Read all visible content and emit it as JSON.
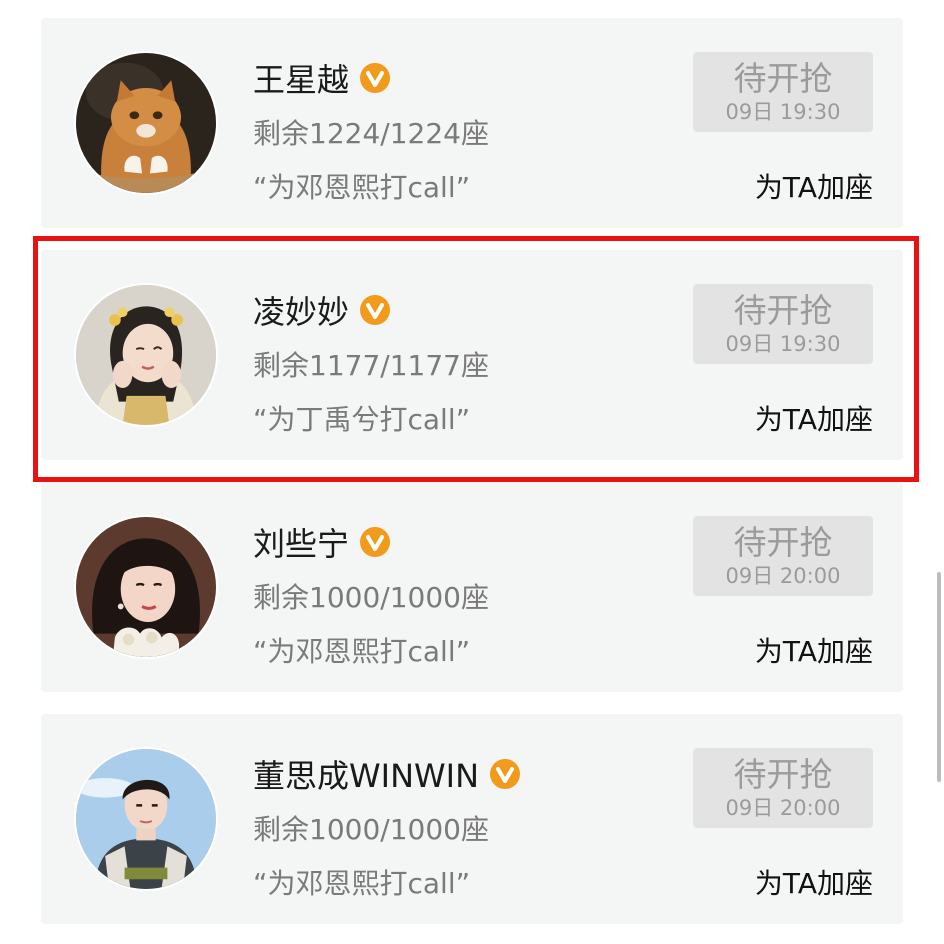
{
  "cards": [
    {
      "name": "王星越",
      "seats": "剩余1224/1224座",
      "slogan": "“为邓恩熙打call”",
      "button_label": "待开抢",
      "button_time": "09日 19:30",
      "add_seat": "为TA加座"
    },
    {
      "name": "凌妙妙",
      "seats": "剩余1177/1177座",
      "slogan": "“为丁禹兮打call”",
      "button_label": "待开抢",
      "button_time": "09日 19:30",
      "add_seat": "为TA加座"
    },
    {
      "name": "刘些宁",
      "seats": "剩余1000/1000座",
      "slogan": "“为邓恩熙打call”",
      "button_label": "待开抢",
      "button_time": "09日 20:00",
      "add_seat": "为TA加座"
    },
    {
      "name": "董思成WINWIN",
      "seats": "剩余1000/1000座",
      "slogan": "“为邓恩熙打call”",
      "button_label": "待开抢",
      "button_time": "09日 20:00",
      "add_seat": "为TA加座"
    }
  ],
  "icons": {
    "badge": "verified-v-icon",
    "avatars": [
      "cat-avatar-image",
      "costume-woman-avatar-image",
      "woman-portrait-avatar-image",
      "man-portrait-avatar-image"
    ]
  },
  "colors": {
    "badge_orange": "#f29a1b",
    "highlight_red": "#e81212",
    "card_background": "#f4f5f5",
    "button_background": "#e3e3e3"
  }
}
